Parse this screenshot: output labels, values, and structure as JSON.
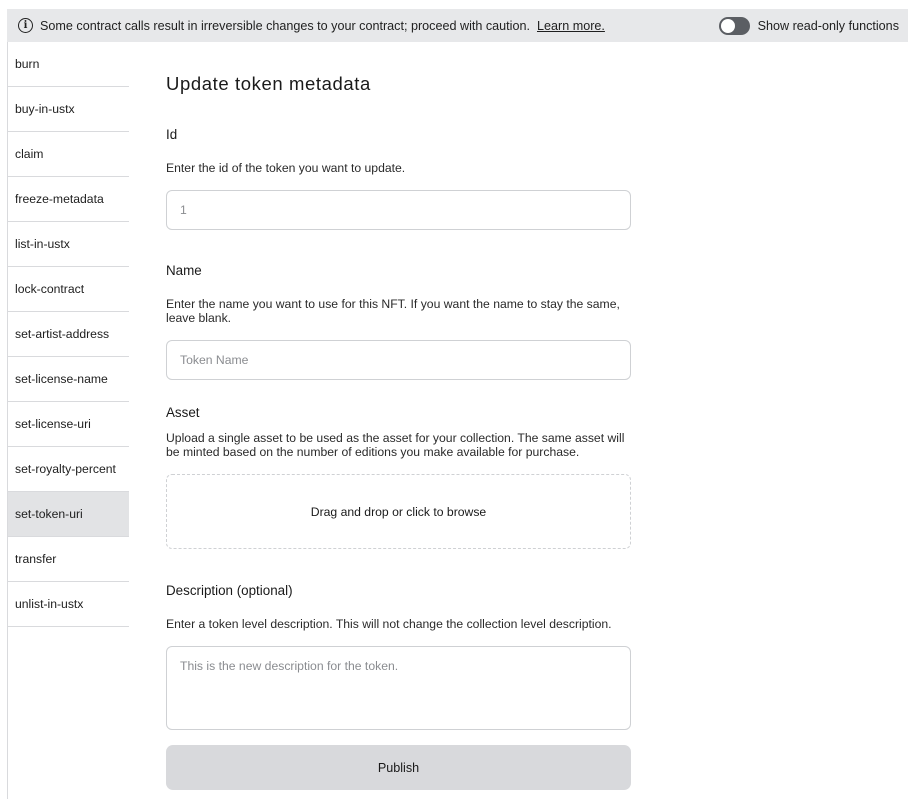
{
  "warning_bar": {
    "icon": "info-icon",
    "message": "Some contract calls result in irreversible changes to your contract; proceed with caution.",
    "link_label": "Learn more.",
    "toggle_on": false,
    "toggle_label": "Show read-only functions"
  },
  "sidebar": {
    "items": [
      {
        "label": "burn",
        "active": false
      },
      {
        "label": "buy-in-ustx",
        "active": false
      },
      {
        "label": "claim",
        "active": false
      },
      {
        "label": "freeze-metadata",
        "active": false
      },
      {
        "label": "list-in-ustx",
        "active": false
      },
      {
        "label": "lock-contract",
        "active": false
      },
      {
        "label": "set-artist-address",
        "active": false
      },
      {
        "label": "set-license-name",
        "active": false
      },
      {
        "label": "set-license-uri",
        "active": false
      },
      {
        "label": "set-royalty-percent",
        "active": false
      },
      {
        "label": "set-token-uri",
        "active": true
      },
      {
        "label": "transfer",
        "active": false
      },
      {
        "label": "unlist-in-ustx",
        "active": false
      }
    ]
  },
  "form": {
    "title": "Update token metadata",
    "id": {
      "label": "Id",
      "help": "Enter the id of the token you want to update.",
      "value": "",
      "placeholder": "1"
    },
    "name": {
      "label": "Name",
      "help": "Enter the name you want to use for this NFT. If you want the name to stay the same, leave blank.",
      "value": "",
      "placeholder": "Token Name"
    },
    "asset": {
      "label": "Asset",
      "help": "Upload a single asset to be used as the asset for your collection. The same asset will be minted based on the number of editions you make available for purchase.",
      "dropzone_text": "Drag and drop or click to browse"
    },
    "description": {
      "label": "Description (optional)",
      "help": "Enter a token level description. This will not change the collection level description.",
      "value": "",
      "placeholder": "This is the new description for the token."
    },
    "publish_label": "Publish"
  }
}
